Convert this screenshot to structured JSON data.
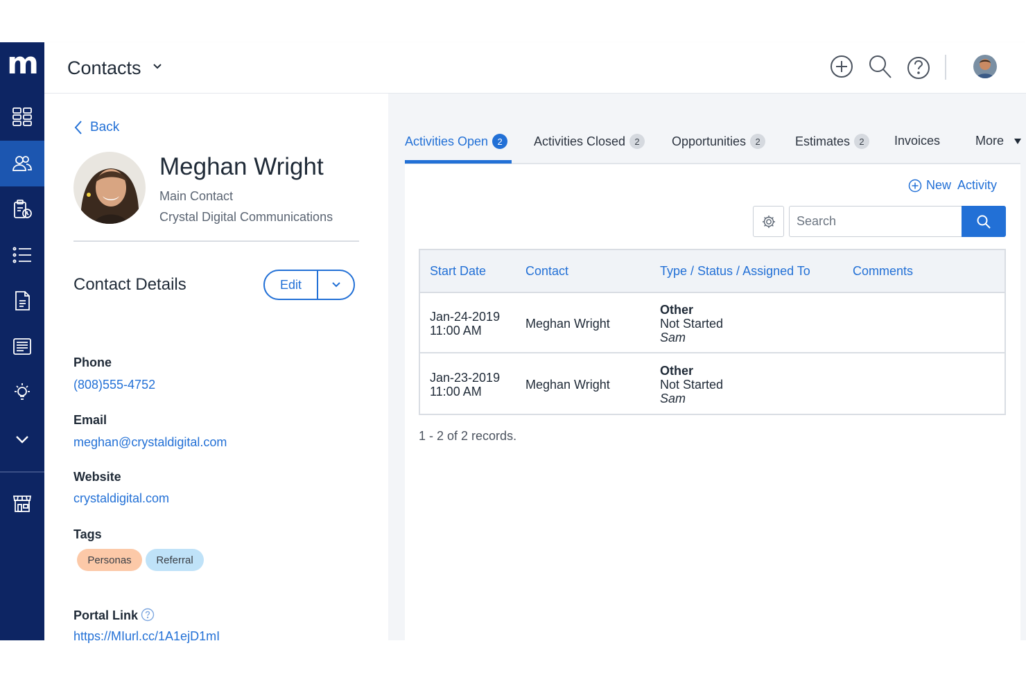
{
  "app": {
    "logo_text": "m",
    "page_title": "Contacts"
  },
  "sidebar": {
    "items": [
      {
        "icon": "dashboard-icon",
        "active": false
      },
      {
        "icon": "contacts-icon",
        "active": true
      },
      {
        "icon": "clipboard-icon",
        "active": false
      },
      {
        "icon": "list-icon",
        "active": false
      },
      {
        "icon": "document-icon",
        "active": false
      },
      {
        "icon": "invoice-icon",
        "active": false
      },
      {
        "icon": "lightbulb-icon",
        "active": false
      },
      {
        "icon": "chevron-down-icon",
        "active": false
      },
      {
        "icon": "storefront-icon",
        "active": false
      }
    ]
  },
  "topbar": {
    "icons": [
      "add-circle-icon",
      "search-icon",
      "help-icon",
      "user-avatar"
    ]
  },
  "contact": {
    "back_label": "Back",
    "name": "Meghan Wright",
    "role": "Main Contact",
    "company": "Crystal Digital Communications"
  },
  "details": {
    "section_title": "Contact Details",
    "edit_label": "Edit",
    "phone_label": "Phone",
    "phone": "(808)555-4752",
    "email_label": "Email",
    "email": "meghan@crystaldigital.com",
    "website_label": "Website",
    "website": "crystaldigital.com",
    "tags_label": "Tags",
    "tags": [
      "Personas",
      "Referral"
    ],
    "portal_label": "Portal Link",
    "portal_url": "https://MIurl.cc/1A1ejD1mI"
  },
  "tabs": [
    {
      "label": "Activities Open",
      "badge": "2",
      "active": true
    },
    {
      "label": "Activities Closed",
      "badge": "2",
      "active": false
    },
    {
      "label": "Opportunities",
      "badge": "2",
      "active": false
    },
    {
      "label": "Estimates",
      "badge": "2",
      "active": false
    },
    {
      "label": "Invoices",
      "badge": "",
      "active": false
    },
    {
      "label": "More",
      "badge": "",
      "active": false
    }
  ],
  "activities": {
    "new_label": "New  Activity",
    "search_placeholder": "Search",
    "columns": [
      "Start Date",
      "Contact",
      "Type / Status / Assigned To",
      "Comments"
    ],
    "rows": [
      {
        "date": "Jan-24-2019",
        "time": "11:00 AM",
        "contact": "Meghan Wright",
        "type": "Other",
        "status": "Not Started",
        "assigned": "Sam",
        "comments": ""
      },
      {
        "date": "Jan-23-2019",
        "time": "11:00 AM",
        "contact": "Meghan Wright",
        "type": "Other",
        "status": "Not Started",
        "assigned": "Sam",
        "comments": ""
      }
    ],
    "records_text": "1 - 2 of 2 records."
  },
  "colors": {
    "sidebar": "#0d2563",
    "sidebar_active": "#1c56b0",
    "accent": "#2270d6",
    "tag_personas": "#fcc9a8",
    "tag_referral": "#bfe2f8"
  }
}
